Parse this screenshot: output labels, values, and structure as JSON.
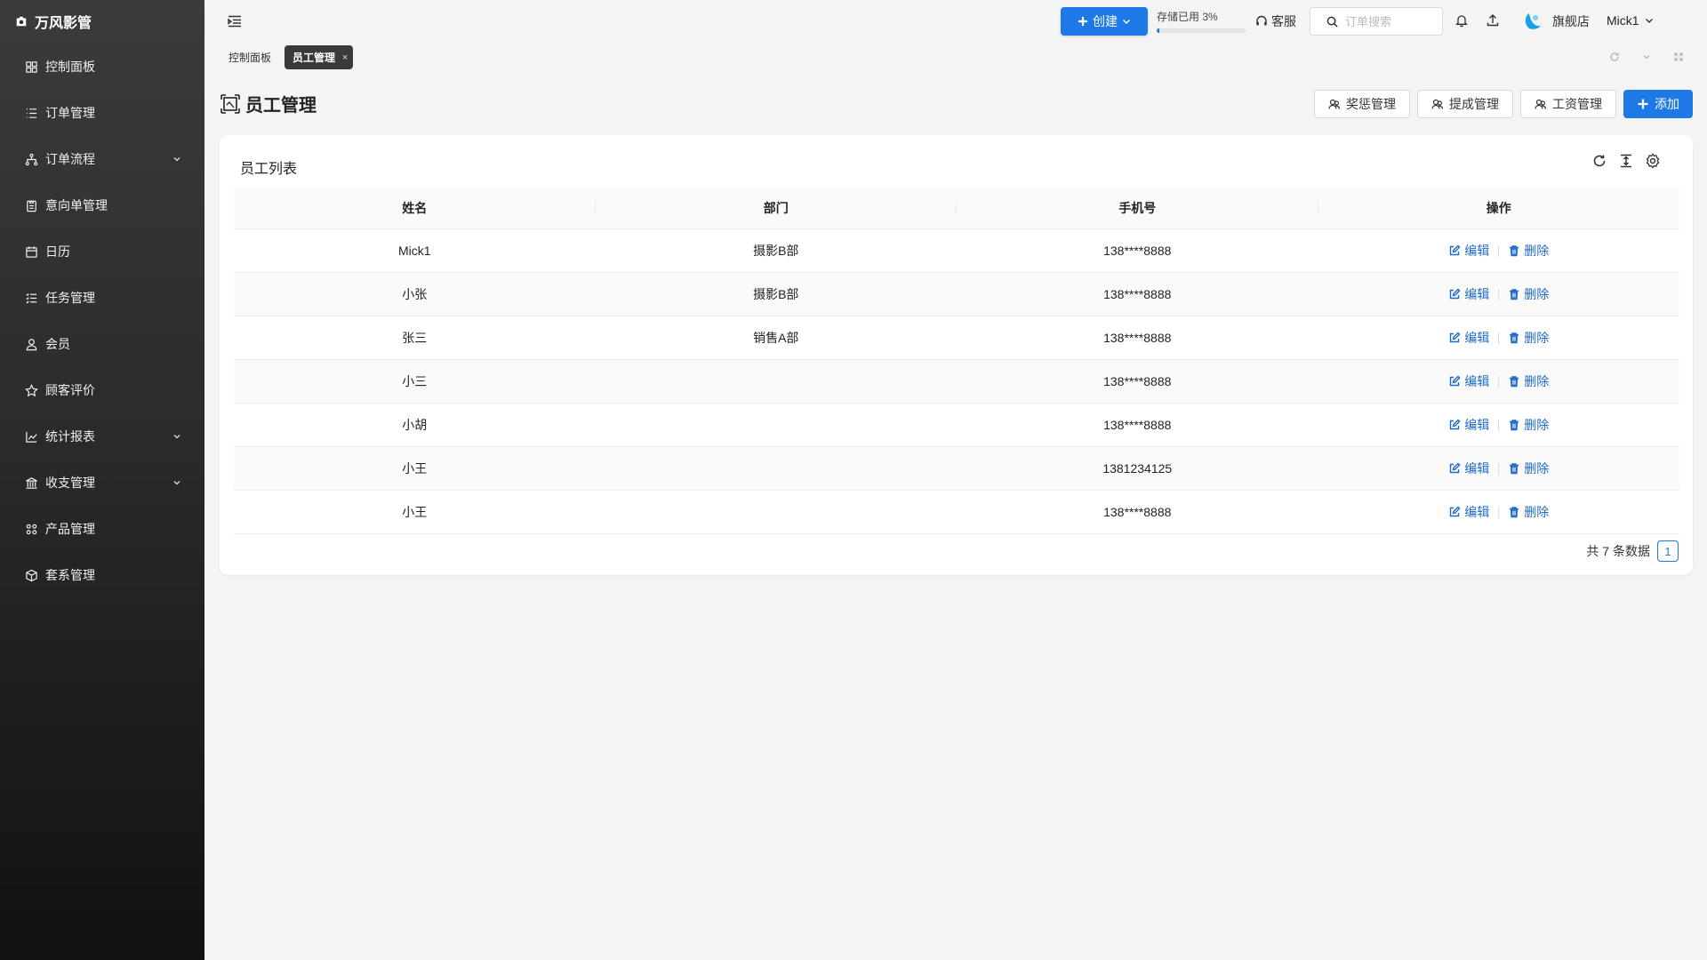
{
  "brand": {
    "name": "万风影管"
  },
  "sidebar": {
    "items": [
      {
        "label": "控制面板",
        "icon": "dashboard-icon",
        "expandable": false
      },
      {
        "label": "订单管理",
        "icon": "list-icon",
        "expandable": false
      },
      {
        "label": "订单流程",
        "icon": "flow-icon",
        "expandable": true
      },
      {
        "label": "意向单管理",
        "icon": "clipboard-icon",
        "expandable": false
      },
      {
        "label": "日历",
        "icon": "calendar-icon",
        "expandable": false
      },
      {
        "label": "任务管理",
        "icon": "tasks-icon",
        "expandable": false
      },
      {
        "label": "会员",
        "icon": "user-icon",
        "expandable": false
      },
      {
        "label": "顾客评价",
        "icon": "star-icon",
        "expandable": false
      },
      {
        "label": "统计报表",
        "icon": "chart-icon",
        "expandable": true
      },
      {
        "label": "收支管理",
        "icon": "bank-icon",
        "expandable": true
      },
      {
        "label": "产品管理",
        "icon": "grid-icon",
        "expandable": false
      },
      {
        "label": "套系管理",
        "icon": "box-icon",
        "expandable": false
      }
    ]
  },
  "header": {
    "create_label": "创建",
    "storage_label": "存储已用 3%",
    "storage_fraction": 0.03,
    "service_label": "客服",
    "search_placeholder": "订单搜索",
    "shop_label": "旗舰店",
    "user_name": "Mick1"
  },
  "tabs": [
    {
      "label": "控制面板",
      "active": false
    },
    {
      "label": "员工管理",
      "active": true,
      "close": "×"
    }
  ],
  "page": {
    "title": "员工管理",
    "actions": {
      "bonus": "奖惩管理",
      "commission": "提成管理",
      "salary": "工资管理",
      "add": "添加"
    }
  },
  "card": {
    "title": "员工列表",
    "columns": [
      "姓名",
      "部门",
      "手机号",
      "操作"
    ],
    "rows": [
      {
        "name": "Mick1",
        "dept": "摄影B部",
        "phone": "138****8888"
      },
      {
        "name": "小张",
        "dept": "摄影B部",
        "phone": "138****8888"
      },
      {
        "name": "张三",
        "dept": "销售A部",
        "phone": "138****8888"
      },
      {
        "name": "小三",
        "dept": "",
        "phone": "138****8888"
      },
      {
        "name": "小胡",
        "dept": "",
        "phone": "138****8888"
      },
      {
        "name": "小王",
        "dept": "",
        "phone": "1381234125"
      },
      {
        "name": "小王",
        "dept": "",
        "phone": "138****8888"
      }
    ],
    "edit_label": "编辑",
    "delete_label": "删除",
    "total_label": "共 7 条数据",
    "current_page": "1"
  },
  "colors": {
    "primary": "#1e78e6",
    "link": "#1e6bc8",
    "sidebar_top": "#3b3b3b",
    "sidebar_bottom": "#111111"
  }
}
